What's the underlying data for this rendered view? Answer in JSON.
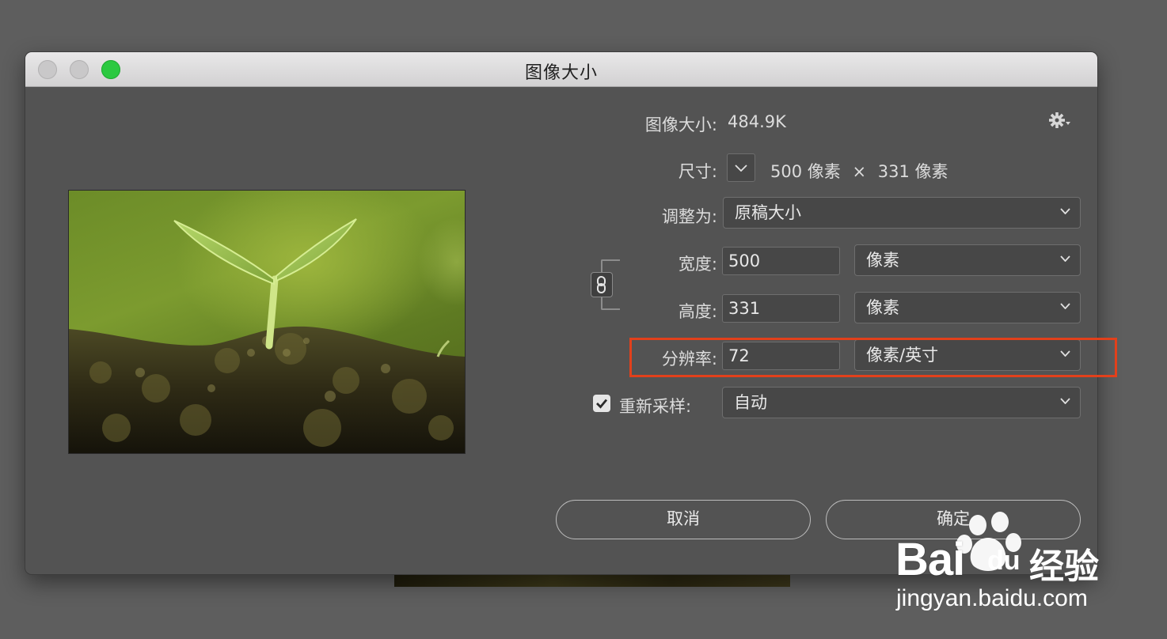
{
  "window": {
    "title": "图像大小"
  },
  "info": {
    "image_size_label": "图像大小:",
    "image_size_value": "484.9K"
  },
  "dimensions": {
    "label": "尺寸:",
    "width_value": "500",
    "width_unit": "像素",
    "separator": "×",
    "height_value": "331",
    "height_unit": "像素"
  },
  "fit_to": {
    "label": "调整为:",
    "value": "原稿大小"
  },
  "width": {
    "label": "宽度:",
    "value": "500",
    "unit": "像素"
  },
  "height": {
    "label": "高度:",
    "value": "331",
    "unit": "像素"
  },
  "resolution": {
    "label": "分辨率:",
    "value": "72",
    "unit": "像素/英寸"
  },
  "resample": {
    "label": "重新采样:",
    "checked": true,
    "value": "自动"
  },
  "buttons": {
    "cancel": "取消",
    "ok": "确定"
  },
  "icons": {
    "gear": "gear-dropdown-icon",
    "link": "chain-link-icon",
    "chevron": "chevron-down-icon",
    "checkbox": "checkmark-icon"
  },
  "annotation": {
    "highlight_color": "#e2401b"
  },
  "watermark": {
    "brand_bai": "Bai",
    "brand_du": "du",
    "brand_jingyan": "经验",
    "url": "jingyan.baidu.com"
  },
  "colors": {
    "window_bg": "#535353",
    "desktop_bg": "#5e5e5e",
    "zoom_button": "#2bc940"
  }
}
